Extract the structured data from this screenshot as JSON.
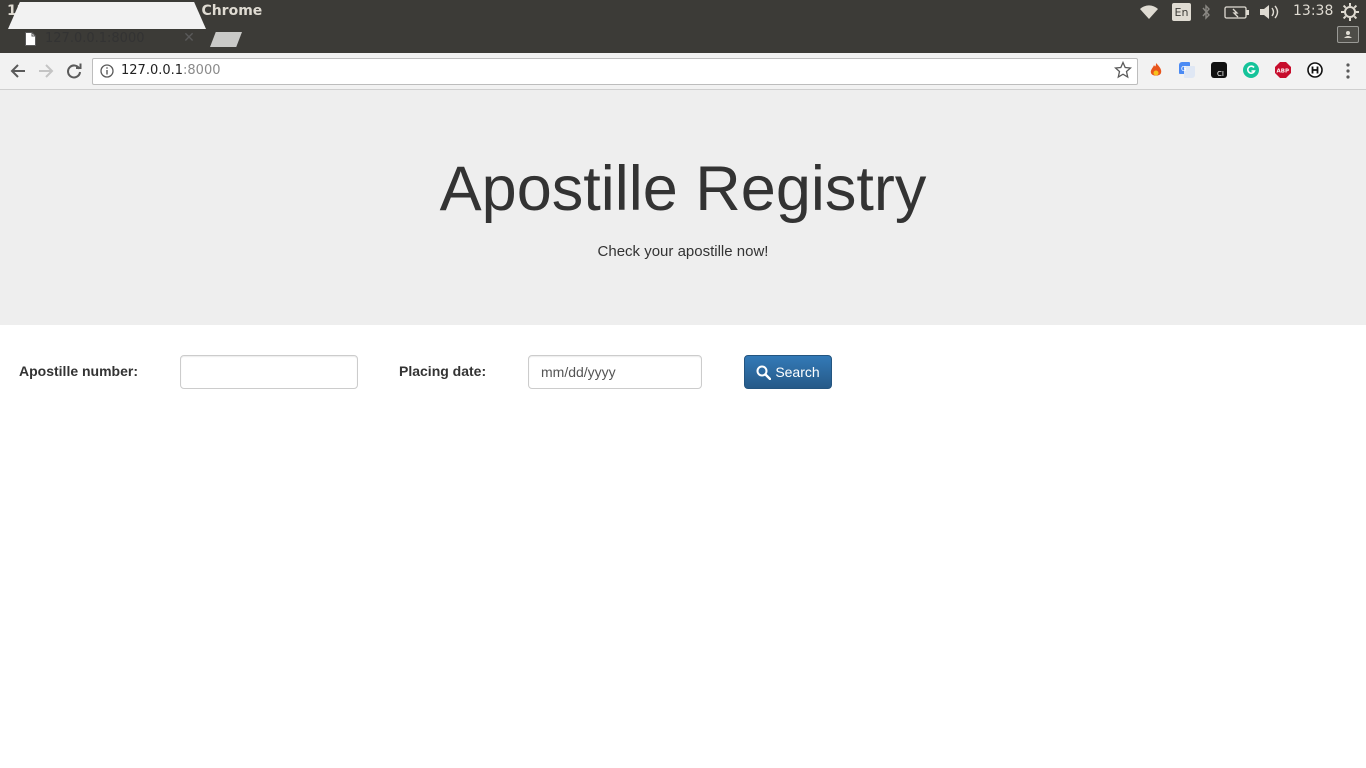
{
  "window": {
    "title": "127.0.0.1:8000 - Google Chrome",
    "tray": {
      "language": "En",
      "clock": "13:38"
    }
  },
  "tabs": [
    {
      "title": "127.0.0.1:8000",
      "active": true
    }
  ],
  "toolbar": {
    "url_host": "127.0.0.1",
    "url_port": ":8000",
    "extensions": [
      "fire-extension-icon",
      "google-translate-icon",
      "ci-extension-icon",
      "grammarly-icon",
      "adblock-plus-icon",
      "h-extension-icon"
    ]
  },
  "jumbotron": {
    "title": "Apostille Registry",
    "subtitle": "Check your apostille now!"
  },
  "form": {
    "apostille_label": "Apostille number:",
    "apostille_value": "",
    "date_label": "Placing date:",
    "date_placeholder": "mm/dd/yyyy",
    "search_label": "Search"
  },
  "colors": {
    "panel": "#3c3b37",
    "jumbotron_bg": "#eeeeee",
    "primary": "#337ab7",
    "text": "#333333"
  }
}
